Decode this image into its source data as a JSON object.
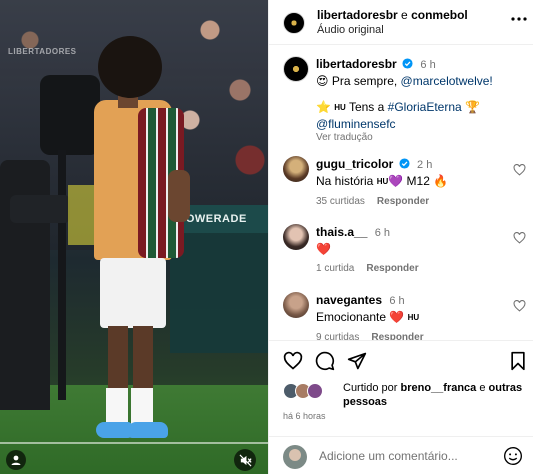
{
  "header": {
    "author": "libertadoresbr",
    "joiner": "e",
    "coauthor": "conmebol",
    "audio": "Áudio original"
  },
  "media": {
    "watermark": "LIBERTADORES",
    "board_text": "POWERADE"
  },
  "caption": {
    "username": "libertadoresbr",
    "time": "6 h",
    "line1_prefix": "😍 Pra sempre, ",
    "line1_mention": "@marcelotwelve!",
    "line2_prefix": "⭐ ",
    "line2_flag": "HU",
    "line2_text": " Tens a ",
    "line2_tag": "#GloriaEterna",
    "line2_suffix": " 🏆",
    "line3_mention": "@fluminensefc",
    "translate": "Ver tradução"
  },
  "comments": [
    {
      "username": "gugu_tricolor",
      "verified": true,
      "time": "2 h",
      "text_a": "Na história ",
      "flag": "HU",
      "text_b": "💜 M12 🔥",
      "likes": "35 curtidas",
      "reply": "Responder"
    },
    {
      "username": "thais.a__",
      "verified": false,
      "time": "6 h",
      "text_a": "❤️",
      "flag": "",
      "text_b": "",
      "likes": "1 curtida",
      "reply": "Responder"
    },
    {
      "username": "navegantes",
      "verified": false,
      "time": "6 h",
      "text_a": "Emocionante ❤️ ",
      "flag": "HU",
      "text_b": "",
      "likes": "9 curtidas",
      "reply": "Responder"
    }
  ],
  "likes": {
    "prefix": "Curtido por ",
    "user": "breno__franca",
    "middle": " e ",
    "others": "outras pessoas"
  },
  "posted": "há 6 horas",
  "add_comment": {
    "placeholder": "Adicione um comentário..."
  },
  "icons": {
    "heart": "heart-icon",
    "comment": "comment-icon",
    "share": "send-icon",
    "save": "bookmark-icon",
    "emoji": "emoji-icon",
    "more": "more-icon",
    "verified": "verified-badge-icon",
    "user": "user-tag-icon",
    "mute": "muted-audio-icon"
  },
  "colors": {
    "link": "#00376b",
    "verified": "#0095f6",
    "heart_red": "#ed4956",
    "muted_text": "#737373"
  }
}
